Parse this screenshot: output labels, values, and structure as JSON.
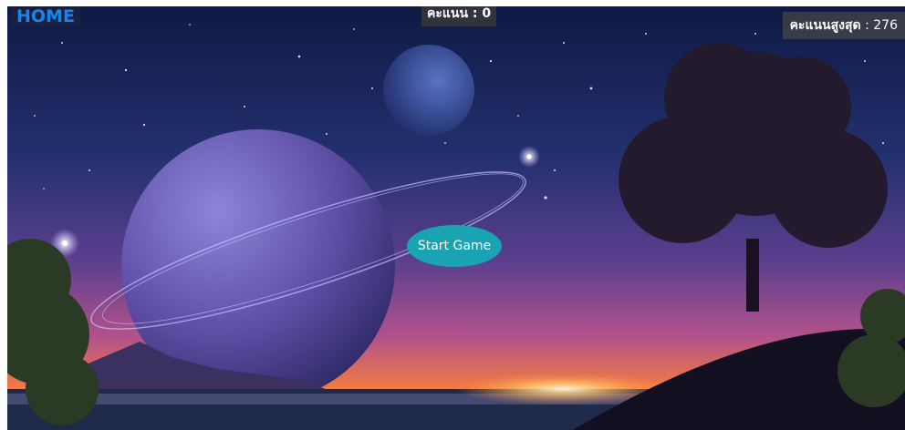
{
  "nav": {
    "home_label": "HOME"
  },
  "score": {
    "label": "คะแนน",
    "separator": " : ",
    "value": "0"
  },
  "best_score": {
    "label": "คะแนนสูงสุด",
    "separator": " : ",
    "value": "276"
  },
  "game": {
    "start_label": "Start Game"
  },
  "colors": {
    "accent": "#1aa3b3",
    "home": "#1a84e8"
  }
}
